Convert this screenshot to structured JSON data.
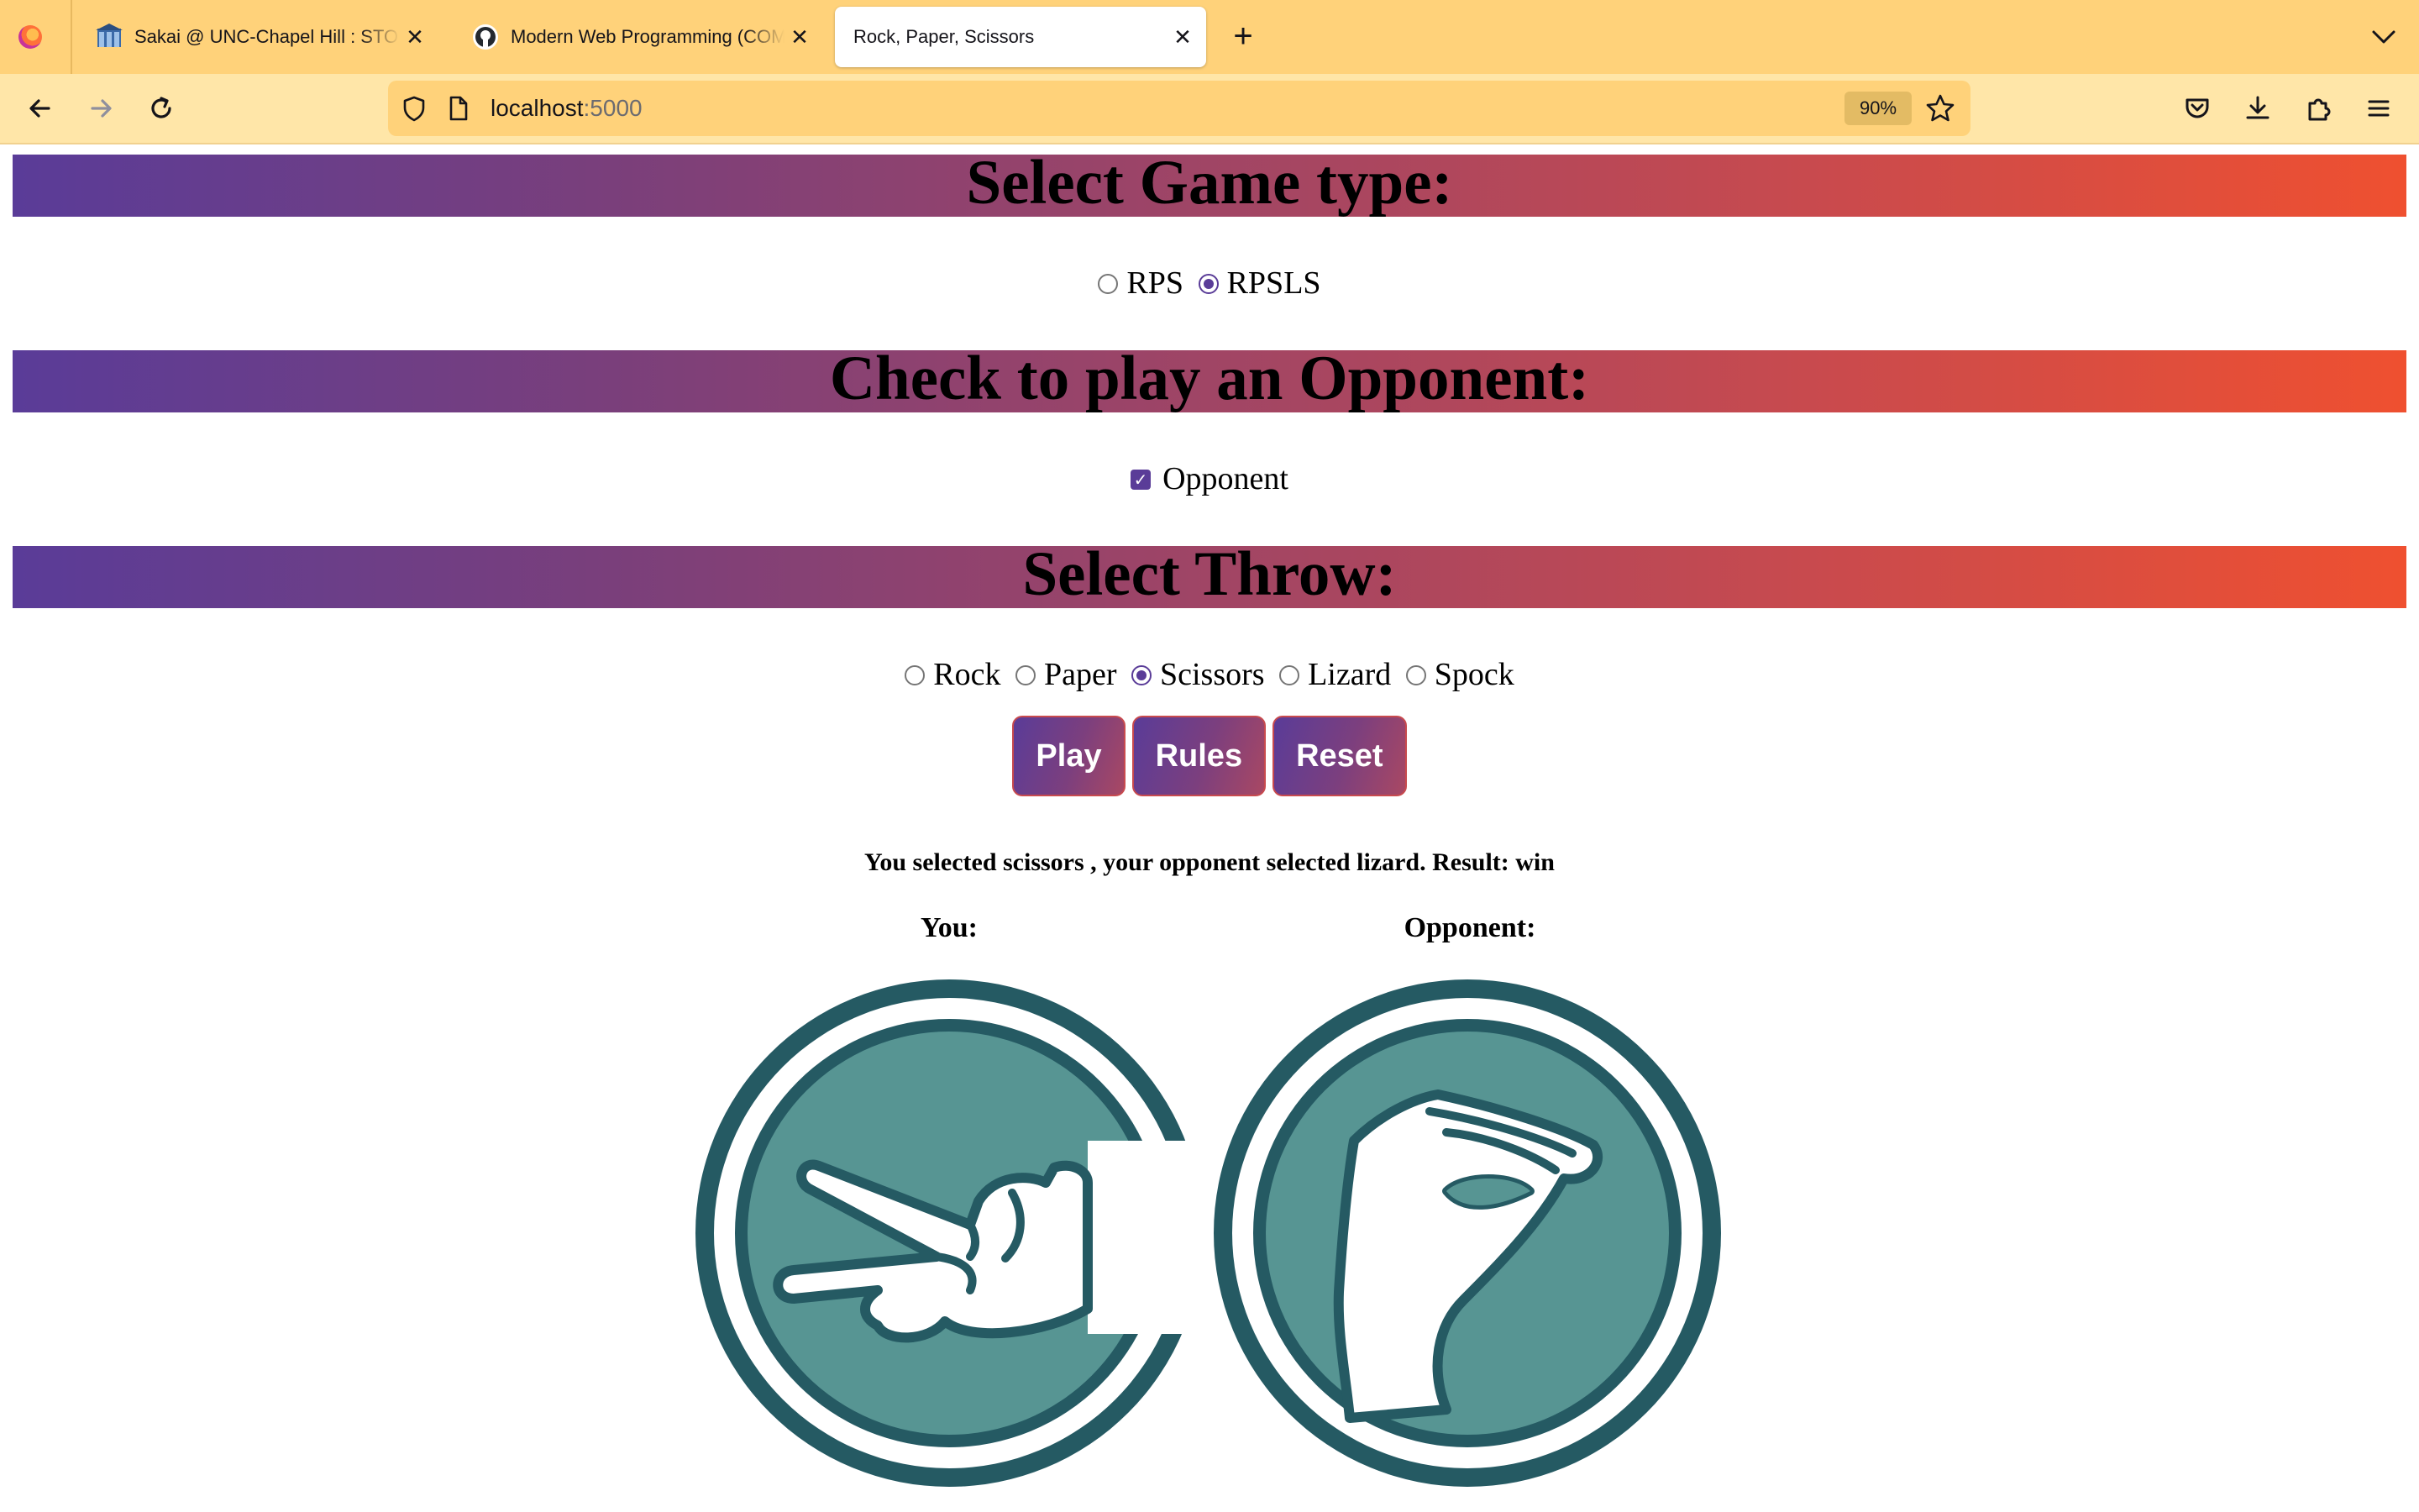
{
  "browser": {
    "tabs": [
      {
        "title": "Sakai @ UNC-Chapel Hill : STOR",
        "active": false
      },
      {
        "title": "Modern Web Programming (COMP",
        "active": false
      },
      {
        "title": "Rock, Paper, Scissors",
        "active": true
      }
    ],
    "url_host": "localhost",
    "url_port": ":5000",
    "zoom": "90%"
  },
  "page": {
    "game_type_heading": "Select Game type:",
    "game_types": [
      {
        "label": "RPS",
        "selected": false
      },
      {
        "label": "RPSLS",
        "selected": true
      }
    ],
    "opponent_heading": "Check to play an Opponent:",
    "opponent_label": "Opponent",
    "opponent_checked": true,
    "throw_heading": "Select Throw:",
    "throws": [
      {
        "label": "Rock",
        "selected": false
      },
      {
        "label": "Paper",
        "selected": false
      },
      {
        "label": "Scissors",
        "selected": true
      },
      {
        "label": "Lizard",
        "selected": false
      },
      {
        "label": "Spock",
        "selected": false
      }
    ],
    "buttons": {
      "play": "Play",
      "rules": "Rules",
      "reset": "Reset"
    },
    "result_text": "You selected scissors , your opponent selected lizard. Result: win",
    "you_label": "You:",
    "opponent_col_label": "Opponent:",
    "you_hand": "scissors",
    "opponent_hand": "lizard"
  },
  "colors": {
    "accent": "#5a3c98",
    "banner_start": "#5a3c98",
    "banner_end": "#ef5030",
    "icon_ring": "#255a63",
    "icon_fill": "#579593",
    "toolbar": "#ffd27a"
  },
  "icons": [
    "firefox-icon",
    "sakai-icon",
    "github-icon",
    "close-icon",
    "plus-icon",
    "chevron-down-icon",
    "back-icon",
    "forward-icon",
    "reload-icon",
    "shield-icon",
    "page-icon",
    "star-icon",
    "pocket-icon",
    "download-icon",
    "extensions-icon",
    "menu-icon"
  ]
}
